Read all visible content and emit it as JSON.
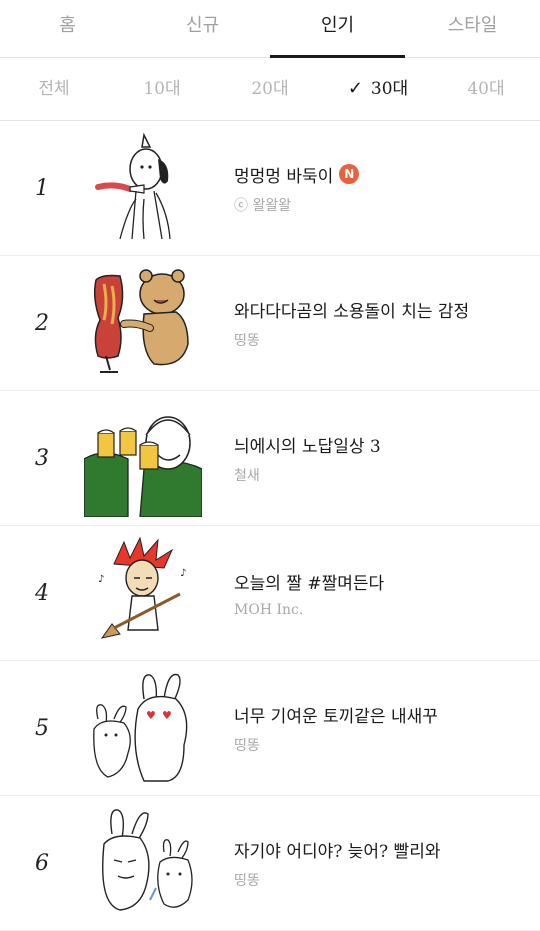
{
  "tabs": [
    {
      "label": "홈"
    },
    {
      "label": "신규"
    },
    {
      "label": "인기"
    },
    {
      "label": "스타일"
    }
  ],
  "age_filters": [
    {
      "label": "전체"
    },
    {
      "label": "10대"
    },
    {
      "label": "20대"
    },
    {
      "label": "30대"
    },
    {
      "label": "40대"
    }
  ],
  "items": [
    {
      "rank": "1",
      "title": "멍멍멍 바둑이",
      "author": "ⓒ 왈왈왈",
      "new_badge": "N"
    },
    {
      "rank": "2",
      "title": "와다다다곰의 소용돌이 치는 감정",
      "author": "띵똥"
    },
    {
      "rank": "3",
      "title": "늬에시의 노답일상 3",
      "author": "철새"
    },
    {
      "rank": "4",
      "title": "오늘의 짤 #짤며든다",
      "author": "MOH Inc."
    },
    {
      "rank": "5",
      "title": "너무 기여운 토끼같은 내새꾸",
      "author": "띵똥"
    },
    {
      "rank": "6",
      "title": "자기야 어디야? 늦어? 빨리와",
      "author": "띵똥"
    }
  ],
  "colors": {
    "accent": "#1a1a1a",
    "new_badge": "#e8613f"
  }
}
